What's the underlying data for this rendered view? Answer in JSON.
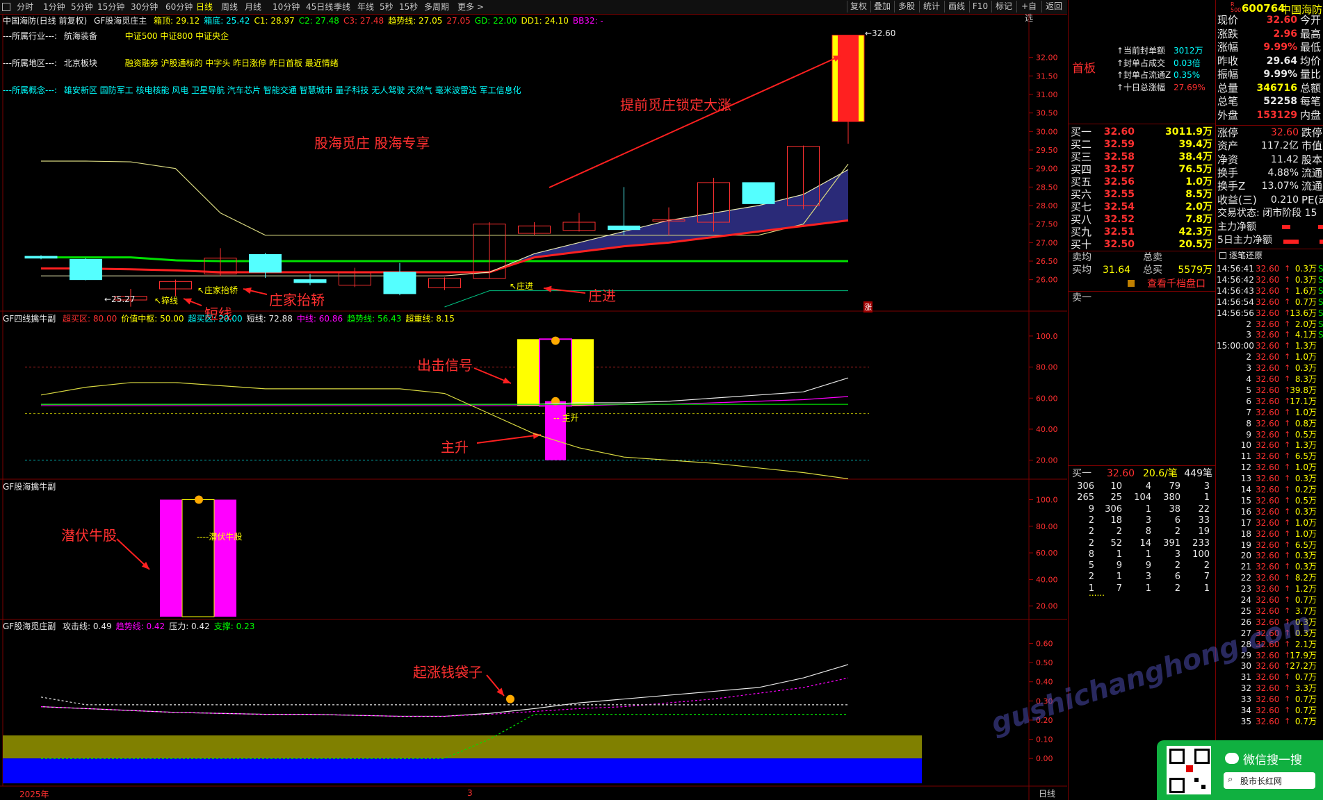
{
  "toolbar": {
    "periods": [
      "分时",
      "1分钟",
      "5分钟",
      "15分钟",
      "30分钟",
      "60分钟",
      "日线",
      "周线",
      "月线",
      "10分钟",
      "45日线",
      "季线",
      "年线",
      "5秒",
      "15秒",
      "多周期",
      "更多 >"
    ],
    "selected": "日线",
    "right_buttons": [
      "复权",
      "叠加",
      "多股",
      "统计",
      "画线",
      "F10",
      "标记",
      "+自选",
      "返回"
    ]
  },
  "main_header": {
    "stock": "中国海防(日线 前复权)",
    "indicator": "GF股海觅庄主",
    "items": [
      {
        "label": "箱顶: 29.12",
        "color": "#ffff00"
      },
      {
        "label": "箱底: 25.42",
        "color": "#00ffff"
      },
      {
        "label": "C1: 28.97",
        "color": "#ffff00"
      },
      {
        "label": "C2: 27.48",
        "color": "#00ff00"
      },
      {
        "label": "C3: 27.48",
        "color": "#ff3030"
      },
      {
        "label": "趋势线: 27.05",
        "color": "#ffff00"
      },
      {
        "label": "27.05",
        "color": "#ff3030"
      },
      {
        "label": "GD: 22.00",
        "color": "#00ff00"
      },
      {
        "label": "DD1: 24.10",
        "color": "#ffff00"
      },
      {
        "label": "BB32: -",
        "color": "#ff00ff"
      }
    ]
  },
  "info": {
    "industry_label": "---所属行业---:",
    "industry": "航海装备",
    "industry_tags": "中证500 中证800 中证央企",
    "region_label": "---所属地区---:",
    "region": "北京板块",
    "region_tags": "融资融券 沪股通标的 中字头 昨日涨停 昨日首板 最近情绪",
    "concept_label": "---所属概念---:",
    "concepts": "雄安新区 国防军工 核电核能 风电 卫星导航 汽车芯片 智能交通 智慧城市 量子科技 无人驾驶 天然气 毫米波雷达 军工信息化"
  },
  "annotations": {
    "title": "股海觅庄 股海专享",
    "lock": "提前觅庄锁定大涨",
    "short_line": "短线",
    "lift": "庄家抬轿",
    "enter": "庄进",
    "signal": "出击信号",
    "main_rise": "主升",
    "hidden_bull": "潜伏牛股",
    "money_bag": "起涨钱袋子",
    "small_lift": "↖庄家抬轿",
    "small_yan": "↖猝线",
    "small_low": "←25.27",
    "small_enter": "↖庄进",
    "small_high": "←32.60",
    "small_zhangsheng": "-- 主升",
    "small_qianfu": "----潜伏牛股",
    "zhang": "涨"
  },
  "chart_data": [
    {
      "type": "candlestick",
      "title": "GF股海觅庄主",
      "ylim": [
        25.3,
        32.8
      ],
      "y_ticks": [
        "32.00",
        "31.50",
        "31.00",
        "30.50",
        "30.00",
        "29.50",
        "29.00",
        "28.50",
        "28.00",
        "27.50",
        "27.00",
        "26.50",
        "26.00"
      ],
      "candles": [
        {
          "o": 26.63,
          "c": 26.58,
          "h": 26.66,
          "l": 26.55
        },
        {
          "o": 26.55,
          "c": 26.0,
          "h": 26.58,
          "l": 25.98
        },
        {
          "o": 25.45,
          "c": 25.55,
          "h": 25.75,
          "l": 25.27
        },
        {
          "o": 25.75,
          "c": 25.95,
          "h": 26.0,
          "l": 25.55
        },
        {
          "o": 26.15,
          "c": 26.58,
          "h": 26.85,
          "l": 26.1
        },
        {
          "o": 26.68,
          "c": 26.2,
          "h": 26.72,
          "l": 26.05
        },
        {
          "o": 26.0,
          "c": 25.92,
          "h": 26.15,
          "l": 25.85
        },
        {
          "o": 25.85,
          "c": 26.18,
          "h": 26.32,
          "l": 25.8
        },
        {
          "o": 26.2,
          "c": 25.62,
          "h": 26.45,
          "l": 25.58
        },
        {
          "o": 25.78,
          "c": 26.03,
          "h": 26.06,
          "l": 25.72
        },
        {
          "o": 26.03,
          "c": 27.5,
          "h": 27.55,
          "l": 26.02
        },
        {
          "o": 27.25,
          "c": 27.45,
          "h": 27.55,
          "l": 27.2
        },
        {
          "o": 27.33,
          "c": 27.55,
          "h": 27.8,
          "l": 27.3
        },
        {
          "o": 27.45,
          "c": 27.35,
          "h": 28.5,
          "l": 27.2
        },
        {
          "o": 27.6,
          "c": 27.62,
          "h": 27.95,
          "l": 27.2
        },
        {
          "o": 27.55,
          "c": 28.62,
          "h": 28.75,
          "l": 27.3
        },
        {
          "o": 28.62,
          "c": 28.05,
          "h": 28.62,
          "l": 28.05
        },
        {
          "o": 28.0,
          "c": 29.6,
          "h": 29.62,
          "l": 27.9
        },
        {
          "o": 30.27,
          "c": 32.6,
          "h": 32.6,
          "l": 29.67
        }
      ],
      "series": [
        {
          "values": [
            29.2,
            29.2,
            29.18,
            29.0,
            27.8,
            27.2,
            27.2,
            27.2,
            27.2,
            27.2,
            27.2,
            27.2,
            27.2,
            27.2,
            27.2,
            27.2,
            27.2,
            27.5,
            29.12
          ]
        },
        {
          "values": [
            26.6,
            26.6,
            26.6,
            26.52,
            26.5,
            26.5,
            26.5,
            26.5,
            26.5,
            26.5,
            26.5,
            26.5,
            26.5,
            26.5,
            26.5,
            26.5,
            26.5,
            26.5,
            26.5
          ]
        },
        {
          "values": [
            26.3,
            26.3,
            26.28,
            26.25,
            26.2,
            26.2,
            26.2,
            26.2,
            26.2,
            26.2,
            26.2,
            26.6,
            26.75,
            26.9,
            27.0,
            27.15,
            27.3,
            27.45,
            27.6
          ]
        },
        {
          "values": [
            26.1,
            26.1,
            26.1,
            26.1,
            26.1,
            26.1,
            26.1,
            26.1,
            26.1,
            26.1,
            26.2,
            26.7,
            27.0,
            27.3,
            27.6,
            27.8,
            28.0,
            28.3,
            28.97
          ]
        },
        {
          "values": [
            25.7,
            25.7,
            25.7,
            25.7,
            25.7,
            25.7,
            25.7,
            25.7,
            25.7,
            25.7,
            25.7,
            25.7,
            25.7,
            25.7,
            25.7,
            25.7,
            25.7,
            25.7,
            25.7
          ]
        }
      ]
    },
    {
      "type": "bar",
      "title": "GF四线擒牛副",
      "legend": [
        {
          "name": "超买区: 80.00",
          "color": "#ff3030"
        },
        {
          "name": "价值中枢: 50.00",
          "color": "#ffff00"
        },
        {
          "name": "超买区: 20.00",
          "color": "#00ffff"
        },
        {
          "name": "短线: 72.88",
          "color": "#e8e8e8"
        },
        {
          "name": "中线: 60.86",
          "color": "#ff00ff"
        },
        {
          "name": "趋势线: 56.43",
          "color": "#00ff00"
        },
        {
          "name": "超重线: 8.15",
          "color": "#ffff00"
        }
      ],
      "ylim": [
        10,
        108
      ],
      "y_ticks": [
        "100.0",
        "80.00",
        "60.00",
        "40.00",
        "20.00"
      ],
      "series": [
        {
          "name": "短线",
          "values": [
            56,
            56,
            56,
            56,
            56,
            56,
            56,
            56,
            56,
            56,
            56,
            56,
            57,
            57,
            58,
            60,
            62,
            64,
            73
          ]
        },
        {
          "name": "中线",
          "values": [
            55,
            55,
            55,
            55,
            55,
            55,
            55,
            55,
            55,
            55,
            55,
            55,
            55,
            56,
            56,
            57,
            58,
            59,
            61
          ]
        },
        {
          "name": "趋势线",
          "values": [
            56,
            56,
            56,
            56,
            56,
            56,
            56,
            56,
            56,
            56,
            56,
            56,
            56,
            56,
            56,
            56,
            56,
            56,
            56
          ]
        },
        {
          "name": "超重线",
          "values": [
            62,
            67,
            70,
            70,
            68,
            66,
            66,
            66,
            66,
            63,
            50,
            37,
            28,
            22,
            20,
            18,
            15,
            12,
            8
          ]
        }
      ]
    },
    {
      "type": "bar",
      "title": "GF股海擒牛副",
      "ylim": [
        12,
        106
      ],
      "y_ticks": [
        "100.0",
        "80.00",
        "60.00",
        "40.00",
        "20.00"
      ]
    },
    {
      "type": "line",
      "title": "GF股海觅庄副",
      "legend": [
        {
          "name": "攻击线: 0.49",
          "color": "#e8e8e8"
        },
        {
          "name": "趋势线: 0.42",
          "color": "#ff00ff"
        },
        {
          "name": "压力: 0.42",
          "color": "#e8e8e8"
        },
        {
          "name": "支撑: 0.23",
          "color": "#00ff00"
        }
      ],
      "ylim": [
        -0.13,
        0.66
      ],
      "y_ticks": [
        "0.60",
        "0.50",
        "0.40",
        "0.30",
        "0.20",
        "0.10",
        "0.00"
      ],
      "series": [
        {
          "name": "攻击线",
          "values": [
            0.27,
            0.26,
            0.25,
            0.24,
            0.235,
            0.23,
            0.23,
            0.225,
            0.22,
            0.22,
            0.235,
            0.26,
            0.29,
            0.31,
            0.33,
            0.35,
            0.37,
            0.42,
            0.49
          ]
        },
        {
          "name": "趋势线",
          "values": [
            0.27,
            0.26,
            0.25,
            0.24,
            0.235,
            0.23,
            0.23,
            0.225,
            0.22,
            0.22,
            0.23,
            0.245,
            0.26,
            0.27,
            0.29,
            0.31,
            0.34,
            0.37,
            0.42
          ]
        },
        {
          "name": "压力",
          "values": [
            0.32,
            0.28,
            0.28,
            0.28,
            0.28,
            0.28,
            0.28,
            0.28,
            0.28,
            0.28,
            0.28,
            0.28,
            0.28,
            0.28,
            0.28,
            0.28,
            0.28,
            0.28,
            0.28
          ]
        },
        {
          "name": "支撑",
          "values": [
            0.0,
            0.0,
            0.0,
            0.0,
            0.0,
            0.0,
            0.0,
            0.0,
            0.0,
            0.0,
            0.1,
            0.23,
            0.23,
            0.23,
            0.23,
            0.23,
            0.23,
            0.23,
            0.23
          ]
        }
      ]
    }
  ],
  "x_axis": {
    "year": "2025年",
    "month": "3",
    "period": "日线"
  },
  "right_panel": {
    "code": "600764",
    "name": "中国海防",
    "badge": "R 500",
    "quote_rows": [
      {
        "l": "现价",
        "v": "32.60",
        "vc": "red",
        "r": "今开"
      },
      {
        "l": "涨跌",
        "v": "2.96",
        "vc": "red",
        "r": "最高"
      },
      {
        "l": "涨幅",
        "v": "9.99%",
        "vc": "red",
        "r": "最低"
      },
      {
        "l": "昨收",
        "v": "29.64",
        "vc": "wht",
        "r": "均价"
      },
      {
        "l": "振幅",
        "v": "9.99%",
        "vc": "wht",
        "r": "量比"
      },
      {
        "l": "总量",
        "v": "346716",
        "vc": "yel",
        "r": "总额"
      },
      {
        "l": "总笔",
        "v": "52258",
        "vc": "wht",
        "r": "每笔"
      },
      {
        "l": "外盘",
        "v": "153129",
        "vc": "red",
        "r": "内盘"
      }
    ],
    "first_board": "首板",
    "seal_info": [
      {
        "l": "当前封单额",
        "v": "3012万"
      },
      {
        "l": "封单占成交",
        "v": "0.03倍"
      },
      {
        "l": "封单占流通Z",
        "v": "0.35%"
      },
      {
        "l": "十日总涨幅",
        "v": "27.69%"
      }
    ],
    "bids": [
      {
        "l": "买一",
        "p": "32.60",
        "v": "3011.9万"
      },
      {
        "l": "买二",
        "p": "32.59",
        "v": "39.4万"
      },
      {
        "l": "买三",
        "p": "32.58",
        "v": "38.4万"
      },
      {
        "l": "买四",
        "p": "32.57",
        "v": "76.5万"
      },
      {
        "l": "买五",
        "p": "32.56",
        "v": "1.0万"
      },
      {
        "l": "买六",
        "p": "32.55",
        "v": "8.5万"
      },
      {
        "l": "买七",
        "p": "32.54",
        "v": "2.0万"
      },
      {
        "l": "买八",
        "p": "32.52",
        "v": "7.8万"
      },
      {
        "l": "买九",
        "p": "32.51",
        "v": "42.3万"
      },
      {
        "l": "买十",
        "p": "32.50",
        "v": "20.5万"
      }
    ],
    "sell_avg": "卖均",
    "buy_avg": "买均",
    "buy_avg_value": "31.64",
    "total_sell": "总卖",
    "total_buy": "总买",
    "total_buy_value": "5579万",
    "view_queue": "查看千档盘口",
    "sell_one": "卖一",
    "fund_rows": [
      {
        "l": "涨停",
        "v": "32.60",
        "vc": "red",
        "r": "跌停"
      },
      {
        "l": "资产",
        "v": "117.2亿",
        "vc": "wht",
        "r": "市值"
      },
      {
        "l": "净资",
        "v": "11.42",
        "vc": "wht",
        "r": "股本"
      },
      {
        "l": "换手",
        "v": "4.88%",
        "vc": "wht",
        "r": "流通"
      },
      {
        "l": "换手Z",
        "v": "13.07%",
        "vc": "wht",
        "r": "流通"
      },
      {
        "l": "收益(三)",
        "v": "0.210",
        "vc": "wht",
        "r": "PE(动"
      }
    ],
    "trade_status": "交易状态: 闭市阶段 15",
    "main_net": "主力净额",
    "main_net_5d": "5日主力净额",
    "tick_header": "逐笔还原",
    "ticks": [
      {
        "t": "14:56:41",
        "p": "32.60",
        "v": "0.3万",
        "s": "S"
      },
      {
        "t": "14:56:42",
        "p": "32.60",
        "v": "0.3万",
        "s": "S"
      },
      {
        "t": "14:56:43",
        "p": "32.60",
        "v": "1.6万",
        "s": "S"
      },
      {
        "t": "14:56:54",
        "p": "32.60",
        "v": "0.7万",
        "s": "S"
      },
      {
        "t": "14:56:56",
        "p": "32.60",
        "v": "13.6万",
        "s": "S"
      },
      {
        "t": "2",
        "p": "32.60",
        "v": "2.0万",
        "s": "S"
      },
      {
        "t": "3",
        "p": "32.60",
        "v": "4.1万",
        "s": "S"
      },
      {
        "t": "15:00:00",
        "p": "32.60",
        "v": "1.3万",
        "s": ""
      },
      {
        "t": "2",
        "p": "32.60",
        "v": "1.0万",
        "s": ""
      },
      {
        "t": "3",
        "p": "32.60",
        "v": "0.3万",
        "s": ""
      },
      {
        "t": "4",
        "p": "32.60",
        "v": "8.3万",
        "s": ""
      },
      {
        "t": "5",
        "p": "32.60",
        "v": "39.8万",
        "s": ""
      },
      {
        "t": "6",
        "p": "32.60",
        "v": "17.1万",
        "s": ""
      },
      {
        "t": "7",
        "p": "32.60",
        "v": "1.0万",
        "s": ""
      },
      {
        "t": "8",
        "p": "32.60",
        "v": "0.8万",
        "s": ""
      },
      {
        "t": "9",
        "p": "32.60",
        "v": "0.5万",
        "s": ""
      },
      {
        "t": "10",
        "p": "32.60",
        "v": "1.3万",
        "s": ""
      },
      {
        "t": "11",
        "p": "32.60",
        "v": "6.5万",
        "s": ""
      },
      {
        "t": "12",
        "p": "32.60",
        "v": "1.0万",
        "s": ""
      },
      {
        "t": "13",
        "p": "32.60",
        "v": "0.3万",
        "s": ""
      },
      {
        "t": "14",
        "p": "32.60",
        "v": "0.2万",
        "s": ""
      },
      {
        "t": "15",
        "p": "32.60",
        "v": "0.5万",
        "s": ""
      },
      {
        "t": "16",
        "p": "32.60",
        "v": "0.3万",
        "s": ""
      },
      {
        "t": "17",
        "p": "32.60",
        "v": "1.0万",
        "s": ""
      },
      {
        "t": "18",
        "p": "32.60",
        "v": "1.0万",
        "s": ""
      },
      {
        "t": "19",
        "p": "32.60",
        "v": "6.5万",
        "s": ""
      },
      {
        "t": "20",
        "p": "32.60",
        "v": "0.3万",
        "s": ""
      },
      {
        "t": "21",
        "p": "32.60",
        "v": "0.3万",
        "s": ""
      },
      {
        "t": "22",
        "p": "32.60",
        "v": "8.2万",
        "s": ""
      },
      {
        "t": "23",
        "p": "32.60",
        "v": "1.2万",
        "s": ""
      },
      {
        "t": "24",
        "p": "32.60",
        "v": "0.7万",
        "s": ""
      },
      {
        "t": "25",
        "p": "32.60",
        "v": "3.7万",
        "s": ""
      },
      {
        "t": "26",
        "p": "32.60",
        "v": "0.3万",
        "s": ""
      },
      {
        "t": "27",
        "p": "32.60",
        "v": "0.3万",
        "s": ""
      },
      {
        "t": "28",
        "p": "32.60",
        "v": "2.1万",
        "s": ""
      },
      {
        "t": "29",
        "p": "32.60",
        "v": "17.9万",
        "s": ""
      },
      {
        "t": "30",
        "p": "32.60",
        "v": "27.2万",
        "s": ""
      },
      {
        "t": "31",
        "p": "32.60",
        "v": "0.7万",
        "s": ""
      },
      {
        "t": "32",
        "p": "32.60",
        "v": "3.3万",
        "s": ""
      },
      {
        "t": "33",
        "p": "32.60",
        "v": "0.7万",
        "s": ""
      },
      {
        "t": "34",
        "p": "32.60",
        "v": "0.7万",
        "s": ""
      },
      {
        "t": "35",
        "p": "32.60",
        "v": "0.7万",
        "s": ""
      }
    ],
    "buy_one_label": "买一",
    "buy_one_price": "32.60",
    "buy_one_avg": "20.6/笔",
    "buy_one_count": "449笔",
    "queue": [
      [
        "306",
        "10",
        "4",
        "79",
        "3"
      ],
      [
        "265",
        "25",
        "104",
        "380",
        "1"
      ],
      [
        "9",
        "306",
        "1",
        "38",
        "22"
      ],
      [
        "2",
        "18",
        "3",
        "6",
        "33"
      ],
      [
        "2",
        "2",
        "8",
        "2",
        "19"
      ],
      [
        "2",
        "52",
        "14",
        "391",
        "233"
      ],
      [
        "8",
        "1",
        "1",
        "3",
        "100"
      ],
      [
        "5",
        "9",
        "9",
        "2",
        "2"
      ],
      [
        "2",
        "1",
        "3",
        "6",
        "7"
      ],
      [
        "1",
        "7",
        "1",
        "2",
        "1"
      ]
    ],
    "queue_more": "......",
    "wechat_search": "微信搜一搜",
    "wechat_name": "股市长红网",
    "watermark": "gushichanghong.com"
  }
}
